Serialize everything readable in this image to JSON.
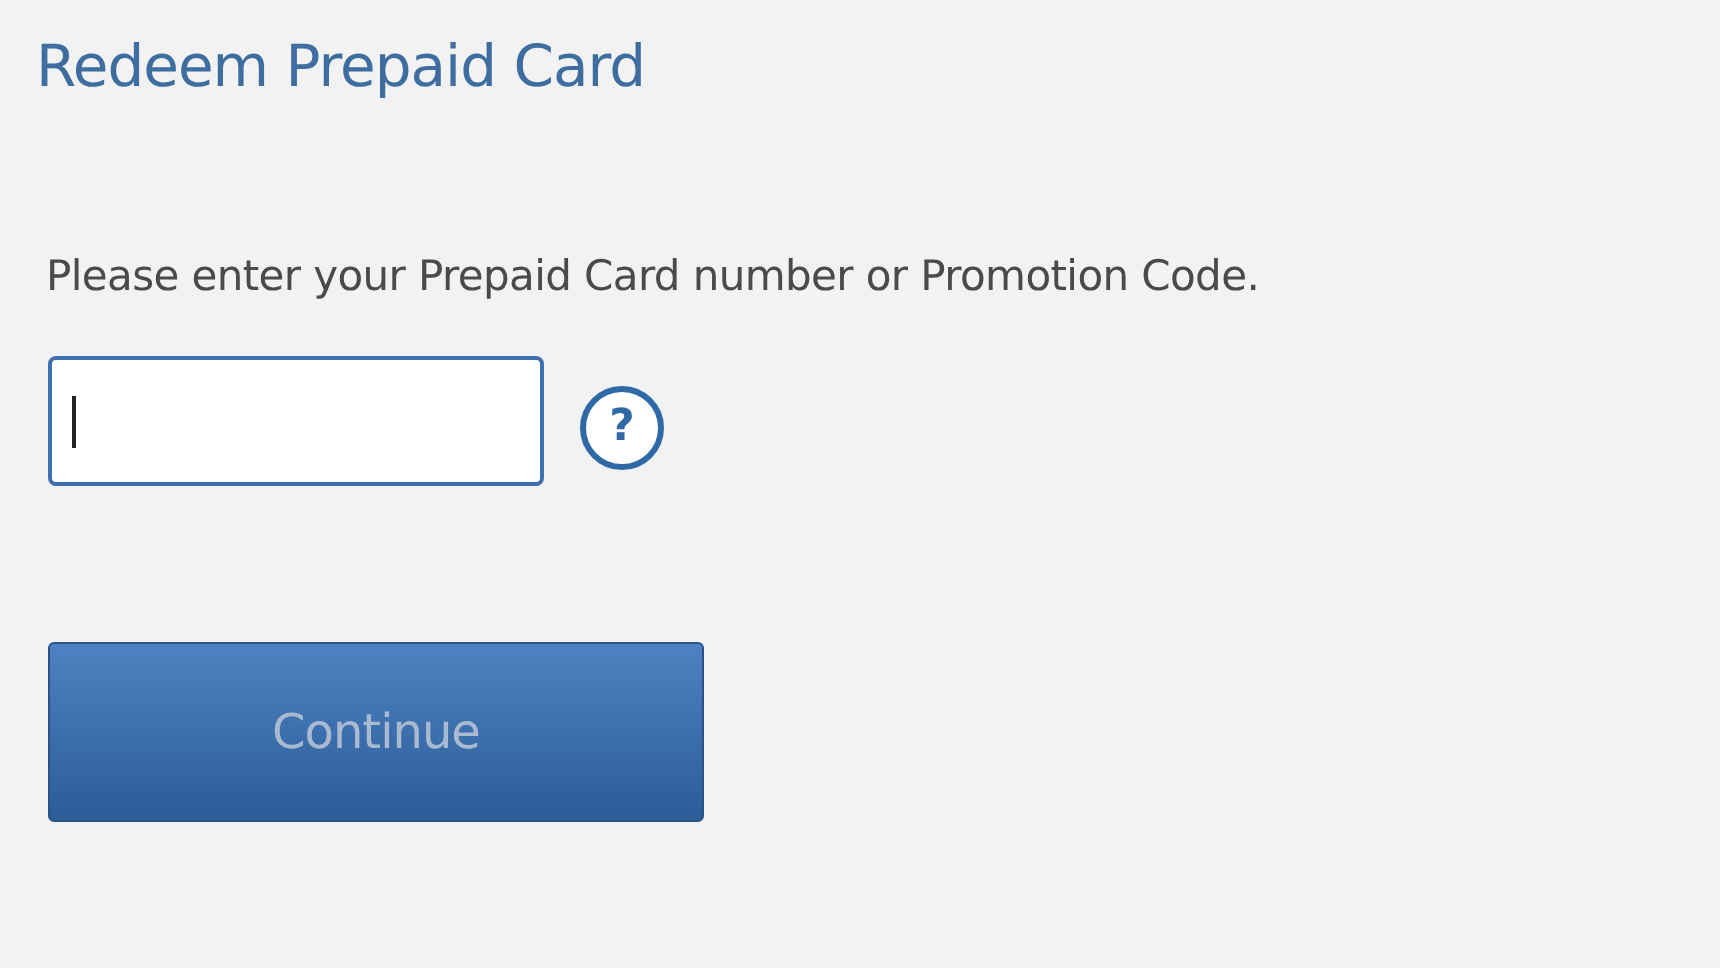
{
  "title": "Redeem Prepaid Card",
  "instruction": "Please enter your Prepaid Card number or Promotion Code.",
  "code_field": {
    "focused": true
  },
  "help_button": {
    "label": "?"
  },
  "continue_button": {
    "label": "Continue",
    "disabled": true
  }
}
